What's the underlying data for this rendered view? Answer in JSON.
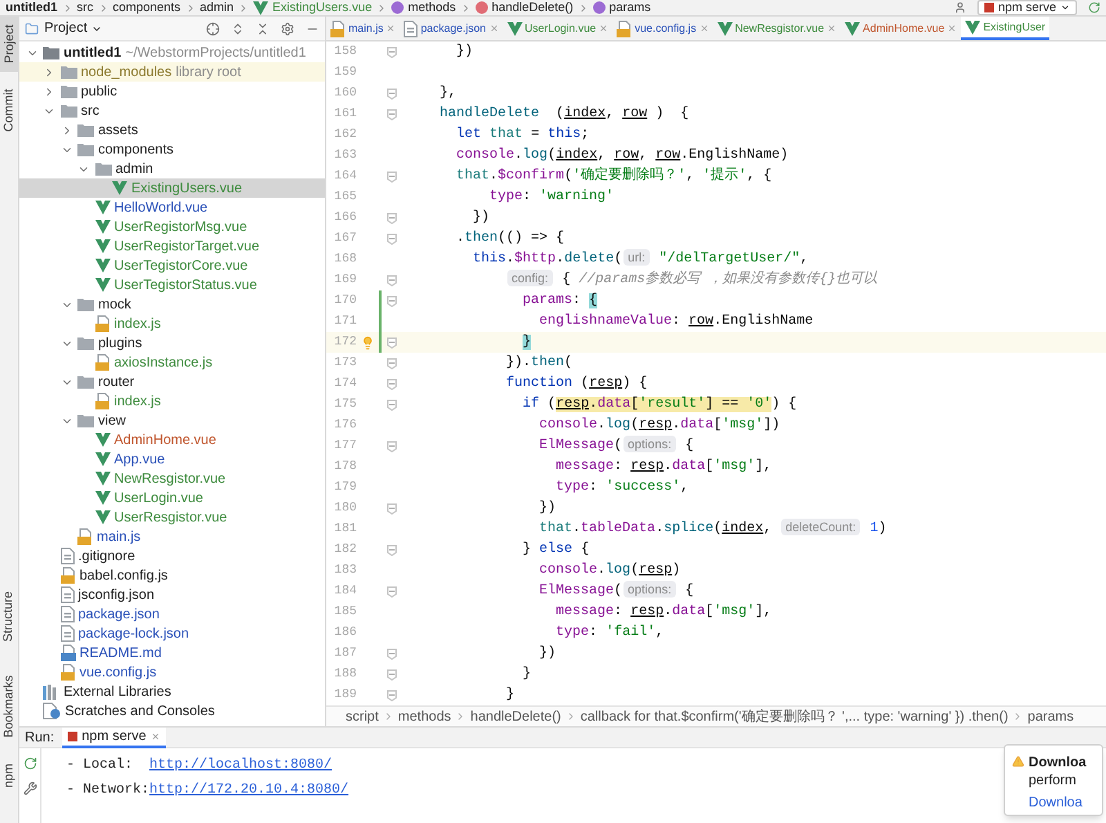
{
  "nav_breadcrumb": [
    {
      "text": "untitled1",
      "kind": "plain"
    },
    {
      "text": "src",
      "kind": "plain"
    },
    {
      "text": "components",
      "kind": "plain"
    },
    {
      "text": "admin",
      "kind": "plain"
    },
    {
      "text": "ExistingUsers.vue",
      "kind": "vue"
    },
    {
      "text": "methods",
      "kind": "property"
    },
    {
      "text": "handleDelete()",
      "kind": "method"
    },
    {
      "text": "params",
      "kind": "property"
    }
  ],
  "run_config": "npm serve",
  "tool_strip": {
    "top": [
      {
        "label": "Project",
        "selected": true
      },
      {
        "label": "Commit",
        "selected": false
      }
    ],
    "bottom": [
      {
        "label": "Structure",
        "selected": false
      },
      {
        "label": "Bookmarks",
        "selected": false
      },
      {
        "label": "npm",
        "selected": false
      }
    ]
  },
  "project_panel": {
    "title": "Project",
    "tree": [
      {
        "name": "untitled1",
        "kind": "project",
        "suffix": "~/WebstormProjects/untitled1",
        "color": "#1f1f1f",
        "expanded": true,
        "selected": false,
        "children": [
          {
            "name": "node_modules",
            "kind": "folder",
            "suffix": "library root",
            "color": "#8c7a2f",
            "expanded": false,
            "selected": false
          },
          {
            "name": "public",
            "kind": "folder",
            "color": "#1f1f1f",
            "expanded": false,
            "selected": false
          },
          {
            "name": "src",
            "kind": "folder",
            "color": "#1f1f1f",
            "expanded": true,
            "selected": false,
            "children": [
              {
                "name": "assets",
                "kind": "folder",
                "color": "#1f1f1f",
                "expanded": false,
                "selected": false
              },
              {
                "name": "components",
                "kind": "folder",
                "color": "#1f1f1f",
                "expanded": true,
                "selected": false,
                "children": [
                  {
                    "name": "admin",
                    "kind": "folder",
                    "color": "#1f1f1f",
                    "expanded": true,
                    "selected": false,
                    "children": [
                      {
                        "name": "ExistingUsers.vue",
                        "kind": "vue",
                        "color": "#3d8b3d",
                        "selected": true
                      }
                    ]
                  },
                  {
                    "name": "HelloWorld.vue",
                    "kind": "vue",
                    "color": "#2950b8",
                    "selected": false
                  },
                  {
                    "name": "UserRegistorMsg.vue",
                    "kind": "vue",
                    "color": "#3d8b3d",
                    "selected": false
                  },
                  {
                    "name": "UserRegistorTarget.vue",
                    "kind": "vue",
                    "color": "#3d8b3d",
                    "selected": false
                  },
                  {
                    "name": "UserTegistorCore.vue",
                    "kind": "vue",
                    "color": "#3d8b3d",
                    "selected": false
                  },
                  {
                    "name": "UserTegistorStatus.vue",
                    "kind": "vue",
                    "color": "#3d8b3d",
                    "selected": false
                  }
                ]
              },
              {
                "name": "mock",
                "kind": "folder",
                "color": "#1f1f1f",
                "expanded": true,
                "selected": false,
                "children": [
                  {
                    "name": "index.js",
                    "kind": "js",
                    "color": "#3d8b3d",
                    "selected": false
                  }
                ]
              },
              {
                "name": "plugins",
                "kind": "folder",
                "color": "#1f1f1f",
                "expanded": true,
                "selected": false,
                "children": [
                  {
                    "name": "axiosInstance.js",
                    "kind": "js",
                    "color": "#3d8b3d",
                    "selected": false
                  }
                ]
              },
              {
                "name": "router",
                "kind": "folder",
                "color": "#1f1f1f",
                "expanded": true,
                "selected": false,
                "children": [
                  {
                    "name": "index.js",
                    "kind": "js",
                    "color": "#3d8b3d",
                    "selected": false
                  }
                ]
              },
              {
                "name": "view",
                "kind": "folder",
                "color": "#1f1f1f",
                "expanded": true,
                "selected": false,
                "children": [
                  {
                    "name": "AdminHome.vue",
                    "kind": "vue",
                    "color": "#c0562e",
                    "selected": false
                  },
                  {
                    "name": "App.vue",
                    "kind": "vue",
                    "color": "#2950b8",
                    "selected": false
                  },
                  {
                    "name": "NewResgistor.vue",
                    "kind": "vue",
                    "color": "#3d8b3d",
                    "selected": false
                  },
                  {
                    "name": "UserLogin.vue",
                    "kind": "vue",
                    "color": "#3d8b3d",
                    "selected": false
                  },
                  {
                    "name": "UserResgistor.vue",
                    "kind": "vue",
                    "color": "#3d8b3d",
                    "selected": false
                  }
                ]
              },
              {
                "name": "main.js",
                "kind": "js",
                "color": "#2950b8",
                "selected": false
              }
            ]
          },
          {
            "name": ".gitignore",
            "kind": "text",
            "color": "#1f1f1f",
            "selected": false
          },
          {
            "name": "babel.config.js",
            "kind": "js",
            "color": "#1f1f1f",
            "selected": false
          },
          {
            "name": "jsconfig.json",
            "kind": "json",
            "color": "#1f1f1f",
            "selected": false
          },
          {
            "name": "package.json",
            "kind": "json",
            "color": "#2950b8",
            "selected": false
          },
          {
            "name": "package-lock.json",
            "kind": "json",
            "color": "#2950b8",
            "selected": false
          },
          {
            "name": "README.md",
            "kind": "md",
            "color": "#2950b8",
            "selected": false
          },
          {
            "name": "vue.config.js",
            "kind": "js",
            "color": "#2950b8",
            "selected": false
          }
        ]
      },
      {
        "name": "External Libraries",
        "kind": "library",
        "color": "#1f1f1f",
        "selected": false
      },
      {
        "name": "Scratches and Consoles",
        "kind": "scratch",
        "color": "#1f1f1f",
        "selected": false
      }
    ]
  },
  "editor_tabs": [
    {
      "label": "main.js",
      "kind": "js",
      "color": "#2950b8",
      "selected": false,
      "closable": true
    },
    {
      "label": "package.json",
      "kind": "json",
      "color": "#2950b8",
      "selected": false,
      "closable": true
    },
    {
      "label": "UserLogin.vue",
      "kind": "vue",
      "color": "#3d8b3d",
      "selected": false,
      "closable": true
    },
    {
      "label": "vue.config.js",
      "kind": "js",
      "color": "#2950b8",
      "selected": false,
      "closable": true
    },
    {
      "label": "NewResgistor.vue",
      "kind": "vue",
      "color": "#3d8b3d",
      "selected": false,
      "closable": true
    },
    {
      "label": "AdminHome.vue",
      "kind": "vue",
      "color": "#c0562e",
      "selected": false,
      "closable": true
    },
    {
      "label": "ExistingUser",
      "kind": "vue",
      "color": "#3d8b3d",
      "selected": true,
      "closable": false
    }
  ],
  "code_lines": [
    {
      "number": "158",
      "fold": true,
      "changed": false,
      "current": false,
      "bulb": false,
      "tokens": [
        {
          "kind": "plain",
          "text": "      })"
        }
      ]
    },
    {
      "number": "159",
      "fold": false,
      "changed": false,
      "current": false,
      "bulb": false
    },
    {
      "number": "160",
      "fold": true,
      "changed": false,
      "current": false,
      "bulb": false,
      "tokens": [
        {
          "kind": "plain",
          "text": "    },"
        }
      ]
    },
    {
      "number": "161",
      "fold": true,
      "changed": false,
      "current": false,
      "bulb": false,
      "tokens": [
        {
          "kind": "fn",
          "text": "    handleDelete"
        },
        {
          "kind": "plain",
          "text": "  ("
        },
        {
          "kind": "param",
          "text": "index"
        },
        {
          "kind": "plain",
          "text": ", "
        },
        {
          "kind": "param",
          "text": "row"
        },
        {
          "kind": "plain",
          "text": " )  {"
        }
      ]
    },
    {
      "number": "162",
      "fold": false,
      "changed": false,
      "current": false,
      "bulb": false,
      "tokens": [
        {
          "kind": "kw",
          "text": "      let"
        },
        {
          "kind": "local",
          "text": " that"
        },
        {
          "kind": "plain",
          "text": " = "
        },
        {
          "kind": "kw",
          "text": "this"
        },
        {
          "kind": "plain",
          "text": ";"
        }
      ]
    },
    {
      "number": "163",
      "fold": false,
      "changed": false,
      "current": false,
      "bulb": false,
      "tokens": [
        {
          "kind": "prop",
          "text": "      console"
        },
        {
          "kind": "plain",
          "text": "."
        },
        {
          "kind": "fn",
          "text": "log"
        },
        {
          "kind": "plain",
          "text": "("
        },
        {
          "kind": "param",
          "text": "index"
        },
        {
          "kind": "plain",
          "text": ", "
        },
        {
          "kind": "param",
          "text": "row"
        },
        {
          "kind": "plain",
          "text": ", "
        },
        {
          "kind": "param",
          "text": "row"
        },
        {
          "kind": "plain",
          "text": ".EnglishName)"
        }
      ]
    },
    {
      "number": "164",
      "fold": true,
      "changed": false,
      "current": false,
      "bulb": false,
      "tokens": [
        {
          "kind": "local",
          "text": "      that"
        },
        {
          "kind": "plain",
          "text": "."
        },
        {
          "kind": "prop",
          "text": "$confirm"
        },
        {
          "kind": "plain",
          "text": "("
        },
        {
          "kind": "str",
          "text": "'确定要删除吗？'"
        },
        {
          "kind": "plain",
          "text": ", "
        },
        {
          "kind": "str",
          "text": "'提示'"
        },
        {
          "kind": "plain",
          "text": ", {"
        }
      ]
    },
    {
      "number": "165",
      "fold": false,
      "changed": false,
      "current": false,
      "bulb": false,
      "tokens": [
        {
          "kind": "prop",
          "text": "          type"
        },
        {
          "kind": "plain",
          "text": ": "
        },
        {
          "kind": "str",
          "text": "'warning'"
        }
      ]
    },
    {
      "number": "166",
      "fold": true,
      "changed": false,
      "current": false,
      "bulb": false,
      "tokens": [
        {
          "kind": "plain",
          "text": "        })"
        }
      ]
    },
    {
      "number": "167",
      "fold": true,
      "changed": false,
      "current": false,
      "bulb": false,
      "tokens": [
        {
          "kind": "plain",
          "text": "      ."
        },
        {
          "kind": "fn",
          "text": "then"
        },
        {
          "kind": "plain",
          "text": "(() => {"
        }
      ]
    },
    {
      "number": "168",
      "fold": false,
      "changed": false,
      "current": false,
      "bulb": false,
      "tokens": [
        {
          "kind": "kw",
          "text": "        this"
        },
        {
          "kind": "plain",
          "text": "."
        },
        {
          "kind": "prop",
          "text": "$http"
        },
        {
          "kind": "plain",
          "text": "."
        },
        {
          "kind": "fn",
          "text": "delete"
        },
        {
          "kind": "plain",
          "text": "("
        },
        {
          "kind": "hint",
          "text": "url:"
        },
        {
          "kind": "str",
          "text": " \"/delTargetUser/\""
        },
        {
          "kind": "plain",
          "text": ","
        }
      ]
    },
    {
      "number": "169",
      "fold": true,
      "changed": false,
      "current": false,
      "bulb": false,
      "tokens": [
        {
          "kind": "hint",
          "text": "            config:"
        },
        {
          "kind": "plain",
          "text": " { "
        },
        {
          "kind": "comment",
          "text": "//params参数必写 ，如果没有参数传{}也可以"
        }
      ]
    },
    {
      "number": "170",
      "fold": true,
      "changed": true,
      "current": false,
      "bulb": false,
      "tokens": [
        {
          "kind": "prop",
          "text": "              params"
        },
        {
          "kind": "plain",
          "text": ": "
        },
        {
          "kind": "brace",
          "text": "{"
        }
      ]
    },
    {
      "number": "171",
      "fold": false,
      "changed": true,
      "current": false,
      "bulb": false,
      "tokens": [
        {
          "kind": "prop",
          "text": "                englishnameValue"
        },
        {
          "kind": "plain",
          "text": ": "
        },
        {
          "kind": "param",
          "text": "row"
        },
        {
          "kind": "plain",
          "text": ".EnglishName"
        }
      ]
    },
    {
      "number": "172",
      "fold": true,
      "changed": true,
      "current": true,
      "bulb": true,
      "tokens": [
        {
          "kind": "brace",
          "text": "              }"
        }
      ]
    },
    {
      "number": "173",
      "fold": true,
      "changed": false,
      "current": false,
      "bulb": false,
      "tokens": [
        {
          "kind": "plain",
          "text": "            })."
        },
        {
          "kind": "fn",
          "text": "then"
        },
        {
          "kind": "plain",
          "text": "("
        }
      ]
    },
    {
      "number": "174",
      "fold": true,
      "changed": false,
      "current": false,
      "bulb": false,
      "tokens": [
        {
          "kind": "kw",
          "text": "            function"
        },
        {
          "kind": "plain",
          "text": " ("
        },
        {
          "kind": "param",
          "text": "resp"
        },
        {
          "kind": "plain",
          "text": ") {"
        }
      ]
    },
    {
      "number": "175",
      "fold": true,
      "changed": false,
      "current": false,
      "bulb": false,
      "tokens": [
        {
          "kind": "kw",
          "text": "              if"
        },
        {
          "kind": "plain",
          "text": " ("
        },
        {
          "kind": "param",
          "text": "resp",
          "highlight": true
        },
        {
          "kind": "plain",
          "text": ".",
          "highlight": true
        },
        {
          "kind": "prop",
          "text": "data",
          "highlight": true
        },
        {
          "kind": "plain",
          "text": "[",
          "highlight": true
        },
        {
          "kind": "str",
          "text": "'result'",
          "highlight": true
        },
        {
          "kind": "plain",
          "text": "] == ",
          "highlight": true
        },
        {
          "kind": "str",
          "text": "'0'",
          "highlight": true
        },
        {
          "kind": "plain",
          "text": ") {"
        }
      ]
    },
    {
      "number": "176",
      "fold": false,
      "changed": false,
      "current": false,
      "bulb": false,
      "tokens": [
        {
          "kind": "prop",
          "text": "                console"
        },
        {
          "kind": "plain",
          "text": "."
        },
        {
          "kind": "fn",
          "text": "log"
        },
        {
          "kind": "plain",
          "text": "("
        },
        {
          "kind": "param",
          "text": "resp"
        },
        {
          "kind": "plain",
          "text": "."
        },
        {
          "kind": "prop",
          "text": "data"
        },
        {
          "kind": "plain",
          "text": "["
        },
        {
          "kind": "str",
          "text": "'msg'"
        },
        {
          "kind": "plain",
          "text": "])"
        }
      ]
    },
    {
      "number": "177",
      "fold": true,
      "changed": false,
      "current": false,
      "bulb": false,
      "tokens": [
        {
          "kind": "prop",
          "text": "                ElMessage"
        },
        {
          "kind": "plain",
          "text": "("
        },
        {
          "kind": "hint",
          "text": "options:"
        },
        {
          "kind": "plain",
          "text": " {"
        }
      ]
    },
    {
      "number": "178",
      "fold": false,
      "changed": false,
      "current": false,
      "bulb": false,
      "tokens": [
        {
          "kind": "prop",
          "text": "                  message"
        },
        {
          "kind": "plain",
          "text": ": "
        },
        {
          "kind": "param",
          "text": "resp"
        },
        {
          "kind": "plain",
          "text": "."
        },
        {
          "kind": "prop",
          "text": "data"
        },
        {
          "kind": "plain",
          "text": "["
        },
        {
          "kind": "str",
          "text": "'msg'"
        },
        {
          "kind": "plain",
          "text": "],"
        }
      ]
    },
    {
      "number": "179",
      "fold": false,
      "changed": false,
      "current": false,
      "bulb": false,
      "tokens": [
        {
          "kind": "prop",
          "text": "                  type"
        },
        {
          "kind": "plain",
          "text": ": "
        },
        {
          "kind": "str",
          "text": "'success'"
        },
        {
          "kind": "plain",
          "text": ","
        }
      ]
    },
    {
      "number": "180",
      "fold": true,
      "changed": false,
      "current": false,
      "bulb": false,
      "tokens": [
        {
          "kind": "plain",
          "text": "                })"
        }
      ]
    },
    {
      "number": "181",
      "fold": false,
      "changed": false,
      "current": false,
      "bulb": false,
      "tokens": [
        {
          "kind": "local",
          "text": "                that"
        },
        {
          "kind": "plain",
          "text": "."
        },
        {
          "kind": "prop",
          "text": "tableData"
        },
        {
          "kind": "plain",
          "text": "."
        },
        {
          "kind": "fn",
          "text": "splice"
        },
        {
          "kind": "plain",
          "text": "("
        },
        {
          "kind": "param",
          "text": "index"
        },
        {
          "kind": "plain",
          "text": ", "
        },
        {
          "kind": "hint",
          "text": "deleteCount:"
        },
        {
          "kind": "num",
          "text": " 1"
        },
        {
          "kind": "plain",
          "text": ")"
        }
      ]
    },
    {
      "number": "182",
      "fold": true,
      "changed": false,
      "current": false,
      "bulb": false,
      "tokens": [
        {
          "kind": "plain",
          "text": "              } "
        },
        {
          "kind": "kw",
          "text": "else"
        },
        {
          "kind": "plain",
          "text": " {"
        }
      ]
    },
    {
      "number": "183",
      "fold": false,
      "changed": false,
      "current": false,
      "bulb": false,
      "tokens": [
        {
          "kind": "prop",
          "text": "                console"
        },
        {
          "kind": "plain",
          "text": "."
        },
        {
          "kind": "fn",
          "text": "log"
        },
        {
          "kind": "plain",
          "text": "("
        },
        {
          "kind": "param",
          "text": "resp"
        },
        {
          "kind": "plain",
          "text": ")"
        }
      ]
    },
    {
      "number": "184",
      "fold": true,
      "changed": false,
      "current": false,
      "bulb": false,
      "tokens": [
        {
          "kind": "prop",
          "text": "                ElMessage"
        },
        {
          "kind": "plain",
          "text": "("
        },
        {
          "kind": "hint",
          "text": "options:"
        },
        {
          "kind": "plain",
          "text": " {"
        }
      ]
    },
    {
      "number": "185",
      "fold": false,
      "changed": false,
      "current": false,
      "bulb": false,
      "tokens": [
        {
          "kind": "prop",
          "text": "                  message"
        },
        {
          "kind": "plain",
          "text": ": "
        },
        {
          "kind": "param",
          "text": "resp"
        },
        {
          "kind": "plain",
          "text": "."
        },
        {
          "kind": "prop",
          "text": "data"
        },
        {
          "kind": "plain",
          "text": "["
        },
        {
          "kind": "str",
          "text": "'msg'"
        },
        {
          "kind": "plain",
          "text": "],"
        }
      ]
    },
    {
      "number": "186",
      "fold": false,
      "changed": false,
      "current": false,
      "bulb": false,
      "tokens": [
        {
          "kind": "prop",
          "text": "                  type"
        },
        {
          "kind": "plain",
          "text": ": "
        },
        {
          "kind": "str",
          "text": "'fail'"
        },
        {
          "kind": "plain",
          "text": ","
        }
      ]
    },
    {
      "number": "187",
      "fold": true,
      "changed": false,
      "current": false,
      "bulb": false,
      "tokens": [
        {
          "kind": "plain",
          "text": "                })"
        }
      ]
    },
    {
      "number": "188",
      "fold": true,
      "changed": false,
      "current": false,
      "bulb": false,
      "tokens": [
        {
          "kind": "plain",
          "text": "              }"
        }
      ]
    },
    {
      "number": "189",
      "fold": true,
      "changed": false,
      "current": false,
      "bulb": false,
      "tokens": [
        {
          "kind": "plain",
          "text": "            }"
        }
      ]
    }
  ],
  "code_breadcrumb": [
    "script",
    "methods",
    "handleDelete()",
    "callback for that.$confirm('确定要删除吗？ ',... type: 'warning' }) .then()",
    "params"
  ],
  "run_panel": {
    "label": "Run:",
    "tab": "npm serve",
    "output": [
      {
        "label": "- Local:",
        "url": "http://localhost:8080/"
      },
      {
        "label": "- Network:",
        "url": "http://172.20.10.4:8080/"
      }
    ]
  },
  "notification": {
    "title": "Downloa",
    "body": "perform",
    "link": "Downloa"
  }
}
